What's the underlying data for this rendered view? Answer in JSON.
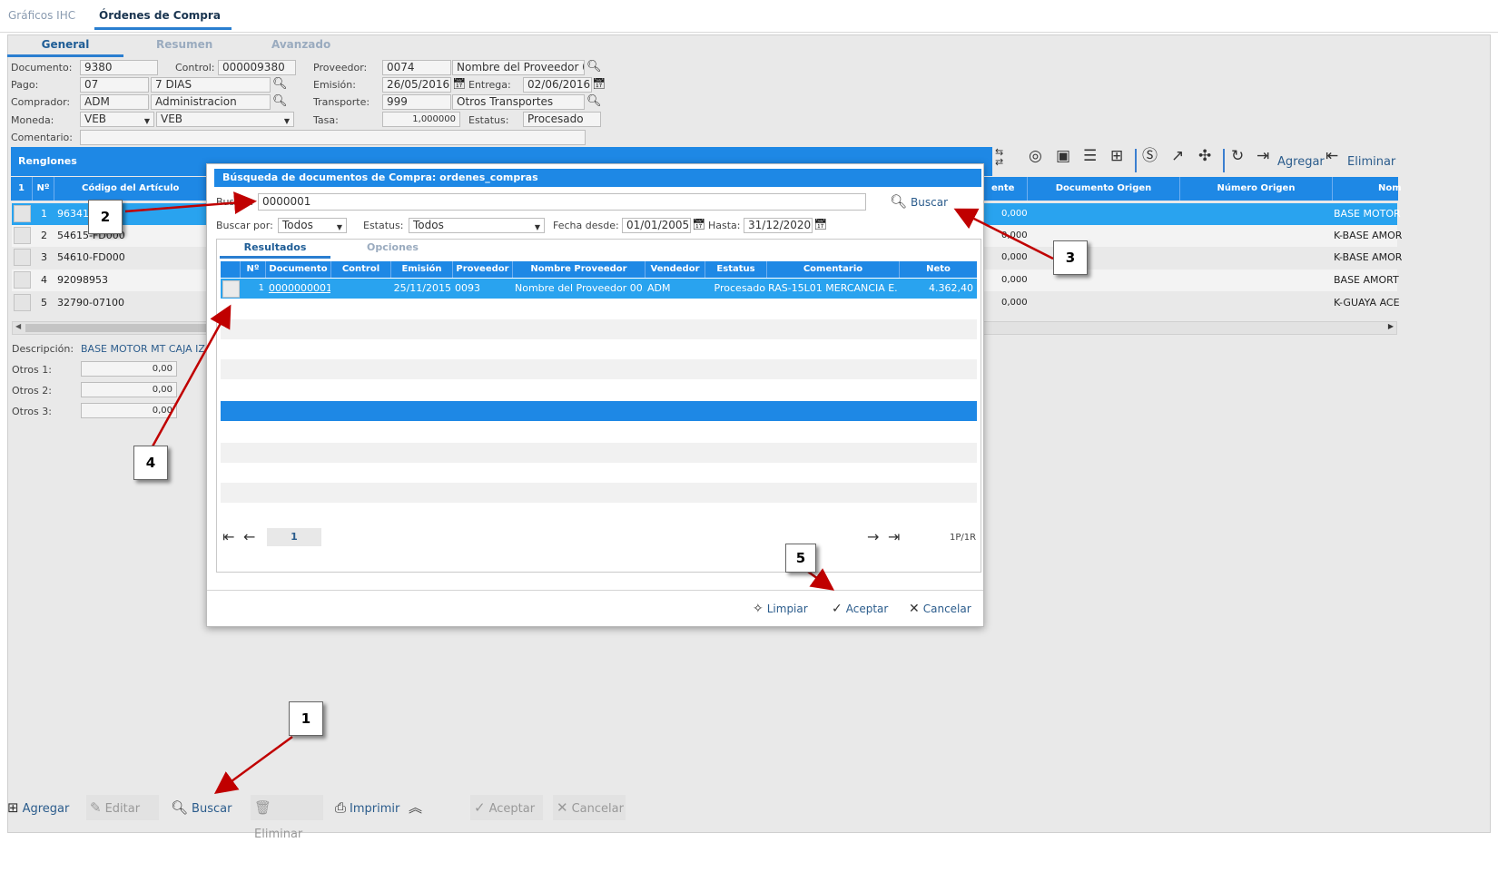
{
  "main_tabs": [
    "Gráficos IHC",
    "Órdenes de Compra"
  ],
  "sub_tabs": [
    "General",
    "Resumen",
    "Avanzado"
  ],
  "form": {
    "documento_label": "Documento:",
    "documento": "9380",
    "control_label": "Control:",
    "control": "000009380",
    "proveedor_label": "Proveedor:",
    "proveedor_code": "0074",
    "proveedor_name": "Nombre del Proveedor 0",
    "pago_label": "Pago:",
    "pago_code": "07",
    "pago_name": "7 DIAS",
    "emision_label": "Emisión:",
    "emision": "26/05/2016",
    "entrega_label": "Entrega:",
    "entrega": "02/06/2016",
    "comprador_label": "Comprador:",
    "comprador_code": "ADM",
    "comprador_name": "Administracion",
    "transporte_label": "Transporte:",
    "transporte_code": "999",
    "transporte_name": "Otros Transportes",
    "moneda_label": "Moneda:",
    "moneda_code": "VEB",
    "moneda_name": "VEB",
    "tasa_label": "Tasa:",
    "tasa": "1,000000",
    "estatus_label": "Estatus:",
    "estatus": "Procesado",
    "comentario_label": "Comentario:",
    "comentario": ""
  },
  "renglones": {
    "title": "Renglones",
    "toolbar_agregar": "Agregar",
    "toolbar_eliminar": "Eliminar",
    "headers": {
      "sel": "1",
      "num": "Nº",
      "codigo": "Código del Artículo",
      "ente": "ente",
      "doc_origen": "Documento Origen",
      "num_origen": "Número Origen",
      "nom": "Nom"
    },
    "rows": [
      {
        "num": "1",
        "codigo": "96341",
        "val": "0,000",
        "nom": "BASE MOTOR"
      },
      {
        "num": "2",
        "codigo": "54615-FD000",
        "val": "0,000",
        "nom": "K-BASE AMOR"
      },
      {
        "num": "3",
        "codigo": "54610-FD000",
        "val": "0,000",
        "nom": "K-BASE AMOR"
      },
      {
        "num": "4",
        "codigo": "92098953",
        "val": "0,000",
        "nom": "BASE AMORT"
      },
      {
        "num": "5",
        "codigo": "32790-07100",
        "val": "0,000",
        "nom": "K-GUAYA ACE"
      }
    ]
  },
  "detail": {
    "descripcion_label": "Descripción:",
    "descripcion": "BASE MOTOR MT CAJA IZ",
    "otros1_label": "Otros 1:",
    "otros1": "0,00",
    "otros2_label": "Otros 2:",
    "otros2": "0,00",
    "otros3_label": "Otros 3:",
    "otros3": "0,00"
  },
  "bottom_toolbar": {
    "agregar": "Agregar",
    "editar": "Editar",
    "buscar": "Buscar",
    "eliminar": "Eliminar",
    "imprimir": "Imprimir",
    "aceptar": "Aceptar",
    "cancelar": "Cancelar"
  },
  "modal": {
    "title": "Búsqueda de documentos de Compra: ordenes_compras",
    "buscar_label": "Buscar:",
    "buscar_value": "0000001",
    "buscar_button": "Buscar",
    "buscar_por_label": "Buscar por:",
    "buscar_por": "Todos",
    "estatus_label": "Estatus:",
    "estatus": "Todos",
    "fecha_desde_label": "Fecha desde:",
    "fecha_desde": "01/01/2005",
    "hasta_label": "Hasta:",
    "hasta": "31/12/2020",
    "tabs": [
      "Resultados",
      "Opciones"
    ],
    "headers": [
      "Nº",
      "Documento",
      "Control",
      "Emisión",
      "Proveedor",
      "Nombre Proveedor",
      "Vendedor",
      "Estatus",
      "Comentario",
      "Neto"
    ],
    "results": [
      {
        "num": "1",
        "documento": "0000000001",
        "control": "",
        "emision": "25/11/2015",
        "proveedor": "0093",
        "nombre": "Nombre del Proveedor 00...",
        "vendedor": "ADM",
        "estatus": "Procesado",
        "comentario": "RAS-15L01 MERCANCIA E...",
        "neto": "4.362,40"
      }
    ],
    "page_number": "1",
    "page_info": "1P/1R",
    "limpiar": "Limpiar",
    "aceptar": "Aceptar",
    "cancelar": "Cancelar"
  },
  "callouts": [
    "1",
    "2",
    "3",
    "4",
    "5"
  ],
  "colors": {
    "accent": "#1e88e5",
    "row_selected": "#29a3ef",
    "arrow": "#c00000"
  }
}
